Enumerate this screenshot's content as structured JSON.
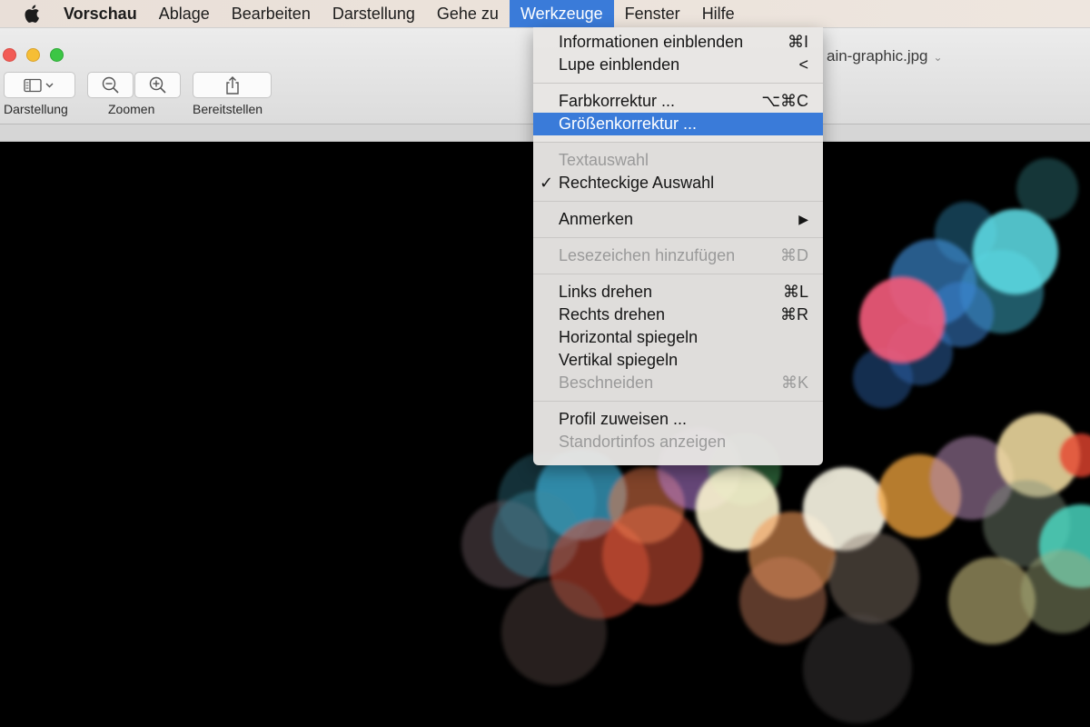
{
  "menubar": {
    "items": [
      {
        "label": "Vorschau"
      },
      {
        "label": "Ablage"
      },
      {
        "label": "Bearbeiten"
      },
      {
        "label": "Darstellung"
      },
      {
        "label": "Gehe zu"
      },
      {
        "label": "Werkzeuge"
      },
      {
        "label": "Fenster"
      },
      {
        "label": "Hilfe"
      }
    ]
  },
  "window": {
    "title": "ain-graphic.jpg",
    "toolbar": {
      "view_label": "Darstellung",
      "zoom_label": "Zoomen",
      "share_label": "Bereitstellen"
    }
  },
  "tools_menu": {
    "info": {
      "label": "Informationen einblenden",
      "shortcut": "⌘I"
    },
    "loupe": {
      "label": "Lupe einblenden",
      "shortcut": "<"
    },
    "color": {
      "label": "Farbkorrektur ...",
      "shortcut": "⌥⌘C"
    },
    "size": {
      "label": "Größenkorrektur ..."
    },
    "text_select": {
      "label": "Textauswahl"
    },
    "rect_select": {
      "label": "Rechteckige Auswahl",
      "check": "✓"
    },
    "annotate": {
      "label": "Anmerken",
      "arrow": "▶"
    },
    "bookmark": {
      "label": "Lesezeichen hinzufügen",
      "shortcut": "⌘D"
    },
    "rotate_left": {
      "label": "Links drehen",
      "shortcut": "⌘L"
    },
    "rotate_right": {
      "label": "Rechts drehen",
      "shortcut": "⌘R"
    },
    "flip_h": {
      "label": "Horizontal spiegeln"
    },
    "flip_v": {
      "label": "Vertikal spiegeln"
    },
    "crop": {
      "label": "Beschneiden",
      "shortcut": "⌘K"
    },
    "profile": {
      "label": "Profil zuweisen ..."
    },
    "location": {
      "label": "Standortinfos anzeigen"
    }
  },
  "colors": {
    "highlight": "#3a7bd9"
  }
}
